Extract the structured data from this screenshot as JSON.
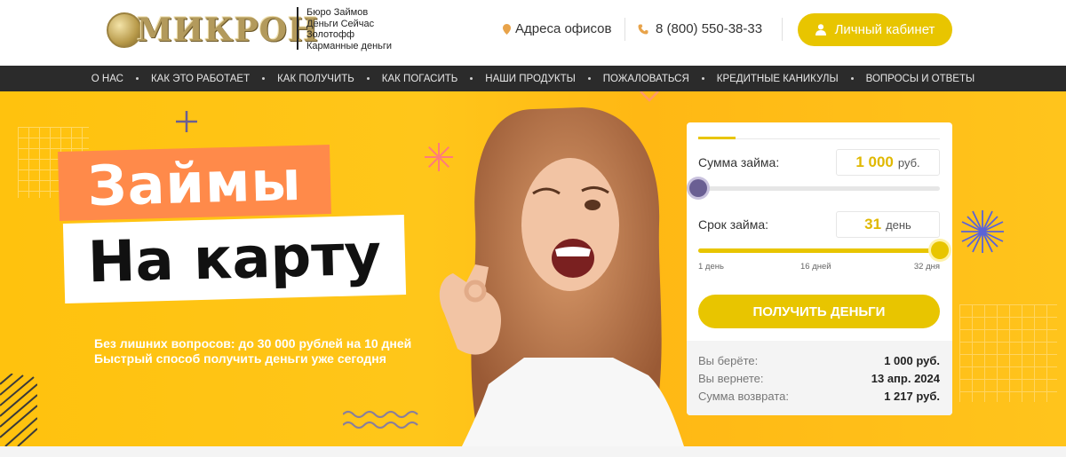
{
  "header": {
    "logo_text": "МИКРОН",
    "brand_lines": [
      "Бюро Займов",
      "Деньги Сейчас",
      "Золотофф",
      "Карманные деньги"
    ],
    "address_label": "Адреса офисов",
    "phone": "8 (800) 550-38-33",
    "cabinet_label": "Личный кабинет"
  },
  "nav": {
    "items": [
      {
        "label": "О нас"
      },
      {
        "label": "Как это работает"
      },
      {
        "label": "Как получить"
      },
      {
        "label": "Как погасить"
      },
      {
        "label": "Наши продукты"
      },
      {
        "label": "Пожаловаться"
      },
      {
        "label": "Кредитные каникулы"
      },
      {
        "label": "Вопросы и ответы"
      }
    ]
  },
  "hero": {
    "title_line1": "Займы",
    "title_line2": "На карту",
    "subtitle_line1": "Без лишних вопросов: до 30 000 рублей на 10 дней",
    "subtitle_line2": "Быстрый способ получить деньги уже сегодня"
  },
  "calculator": {
    "amount_label": "Сумма займа:",
    "amount_value": "1 000",
    "amount_unit": "руб.",
    "amount_fraction": 0.0,
    "term_label": "Срок займа:",
    "term_value": "31",
    "term_unit": "день",
    "term_fraction": 1.0,
    "ticks": [
      "1 день",
      "16 дней",
      "32 дня"
    ],
    "button_label": "ПОЛУЧИТЬ ДЕНЬГИ",
    "summary": [
      {
        "label": "Вы берёте:",
        "value": "1 000 руб."
      },
      {
        "label": "Вы вернете:",
        "value": "13 апр. 2024"
      },
      {
        "label": "Сумма возврата:",
        "value": "1 217 руб."
      }
    ]
  },
  "colors": {
    "accent": "#e8c500",
    "hero_bg": "#ffc20e",
    "nav_bg": "#2b2b2b",
    "title_orange": "#ff8a4a",
    "slider_knob": "#6a5f93"
  }
}
